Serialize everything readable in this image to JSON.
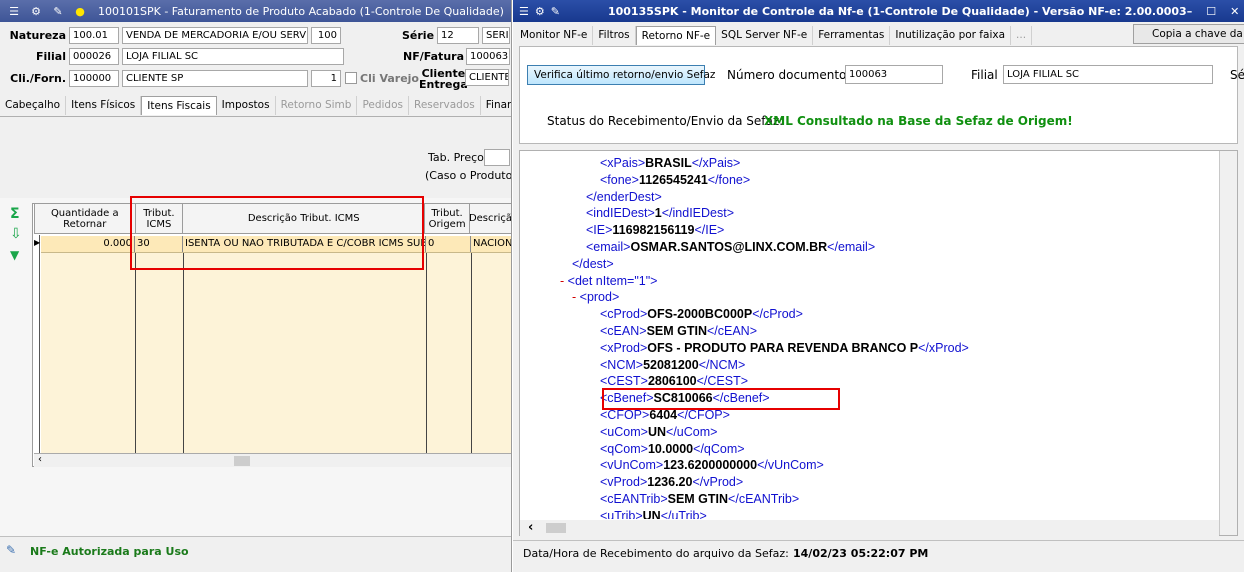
{
  "left": {
    "title": "100101SPK - Faturamento de Produto Acabado (1-Controle De Qualidade)",
    "natureza_label": "Natureza",
    "natureza_code": "100.01",
    "natureza_desc": "VENDA DE MERCADORIA E/OU SERVI",
    "natureza_num": "100",
    "serie_label": "Série",
    "serie_value": "12",
    "serie_extra": "SERI",
    "filial_label": "Filial",
    "filial_code": "000026",
    "filial_name": "LOJA FILIAL SC",
    "nf_label": "NF/Fatura",
    "nf_value": "100063",
    "cli_label": "Cli./Forn.",
    "cli_code": "100000",
    "cli_name": "CLIENTE SP",
    "cli_num": "1",
    "cli_varejo": "Cli Varejo",
    "entrega_label1": "Cliente",
    "entrega_label2": "Entrega",
    "entrega_value": "CLIENTE",
    "tabs": [
      "Cabeçalho",
      "Itens Físicos",
      "Itens Fiscais",
      "Impostos",
      "Retorno Simb",
      "Pedidos",
      "Reservados",
      "Finance"
    ],
    "tab_preco_label": "Tab. Preço",
    "tab_preco_note": "(Caso o Produto/N",
    "grid_headers": [
      "Quantidade a Retornar",
      "Tribut. ICMS",
      "Descrição Tribut. ICMS",
      "Tribut. Origem",
      "Descriçã"
    ],
    "grid_row": [
      "0.000",
      "30",
      "ISENTA OU NAO TRIBUTADA E C/COBR ICMS SUB",
      "0",
      "NACION"
    ],
    "status": "NF-e Autorizada para Uso"
  },
  "right": {
    "title": "100135SPK - Monitor de Controle da Nf-e (1-Controle De Qualidade) - Versão NF-e: 2.00.0003",
    "tabs": [
      "Monitor NF-e",
      "Filtros",
      "Retorno NF-e",
      "SQL Server NF-e",
      "Ferramentas",
      "Inutilização por faixa",
      "..."
    ],
    "copy_button": "Copia a chave da N",
    "verify_button": "Verifica último retorno/envio Sefaz",
    "numdoc_label": "Número documento",
    "numdoc_value": "100063",
    "filial_label": "Filial",
    "filial_value": "LOJA FILIAL SC",
    "extra": "Sé",
    "status_label": "Status do Recebimento/Envio da Sefaz:",
    "status_value": "XML Consultado na Base da Sefaz de Origem!",
    "footer_label": "Data/Hora de Recebimento do arquivo da Sefaz:",
    "footer_value": "14/02/23 05:22:07 PM",
    "xml_lines": [
      {
        "ind": 6,
        "open": "xPais",
        "val": "BRASIL",
        "close": "xPais"
      },
      {
        "ind": 6,
        "open": "fone",
        "val": "1126545241",
        "close": "fone"
      },
      {
        "ind": 5,
        "only": "</enderDest>"
      },
      {
        "ind": 5,
        "open": "indIEDest",
        "val": "1",
        "close": "indIEDest"
      },
      {
        "ind": 5,
        "open": "IE",
        "val": "116982156119",
        "close": "IE"
      },
      {
        "ind": 5,
        "open": "email",
        "val": "OSMAR.SANTOS@LINX.COM.BR",
        "close": "email"
      },
      {
        "ind": 4,
        "only": "</dest>"
      },
      {
        "ind": 3,
        "mk": "- ",
        "only": "<det nItem=\"1\">"
      },
      {
        "ind": 4,
        "mk": "- ",
        "only": "<prod>"
      },
      {
        "ind": 6,
        "open": "cProd",
        "val": "OFS-2000BC000P",
        "close": "cProd"
      },
      {
        "ind": 6,
        "open": "cEAN",
        "val": "SEM GTIN",
        "close": "cEAN"
      },
      {
        "ind": 6,
        "open": "xProd",
        "val": "OFS - PRODUTO PARA REVENDA BRANCO P",
        "close": "xProd"
      },
      {
        "ind": 6,
        "open": "NCM",
        "val": "52081200",
        "close": "NCM"
      },
      {
        "ind": 6,
        "open": "CEST",
        "val": "2806100",
        "close": "CEST"
      },
      {
        "ind": 6,
        "open": "cBenef",
        "val": "SC810066",
        "close": "cBenef"
      },
      {
        "ind": 6,
        "open": "CFOP",
        "val": "6404",
        "close": "CFOP"
      },
      {
        "ind": 6,
        "open": "uCom",
        "val": "UN",
        "close": "uCom"
      },
      {
        "ind": 6,
        "open": "qCom",
        "val": "10.0000",
        "close": "qCom"
      },
      {
        "ind": 6,
        "open": "vUnCom",
        "val": "123.6200000000",
        "close": "vUnCom"
      },
      {
        "ind": 6,
        "open": "vProd",
        "val": "1236.20",
        "close": "vProd"
      },
      {
        "ind": 6,
        "open": "cEANTrib",
        "val": "SEM GTIN",
        "close": "cEANTrib"
      },
      {
        "ind": 6,
        "open": "uTrib",
        "val": "UN",
        "close": "uTrib"
      }
    ]
  }
}
